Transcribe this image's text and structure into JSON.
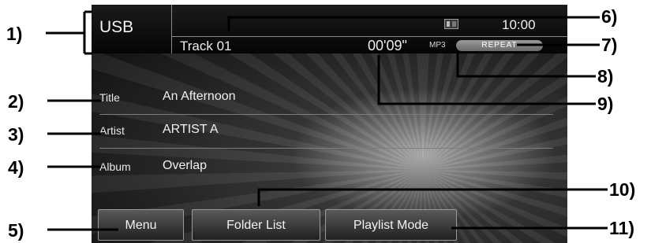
{
  "header": {
    "source": "USB",
    "track": "Track 01",
    "elapsed": "00'09\"",
    "format": "MP3",
    "repeat": "REPEAT",
    "clock": "10:00"
  },
  "info": [
    {
      "label": "Title",
      "value": "An Afternoon"
    },
    {
      "label": "Artist",
      "value": "ARTIST A"
    },
    {
      "label": "Album",
      "value": "Overlap"
    }
  ],
  "buttons": {
    "menu": "Menu",
    "folder_list": "Folder List",
    "playlist_mode": "Playlist Mode"
  },
  "callouts": {
    "c1": "1)",
    "c2": "2)",
    "c3": "3)",
    "c4": "4)",
    "c5": "5)",
    "c6": "6)",
    "c7": "7)",
    "c8": "8)",
    "c9": "9)",
    "c10": "10)",
    "c11": "11)"
  }
}
